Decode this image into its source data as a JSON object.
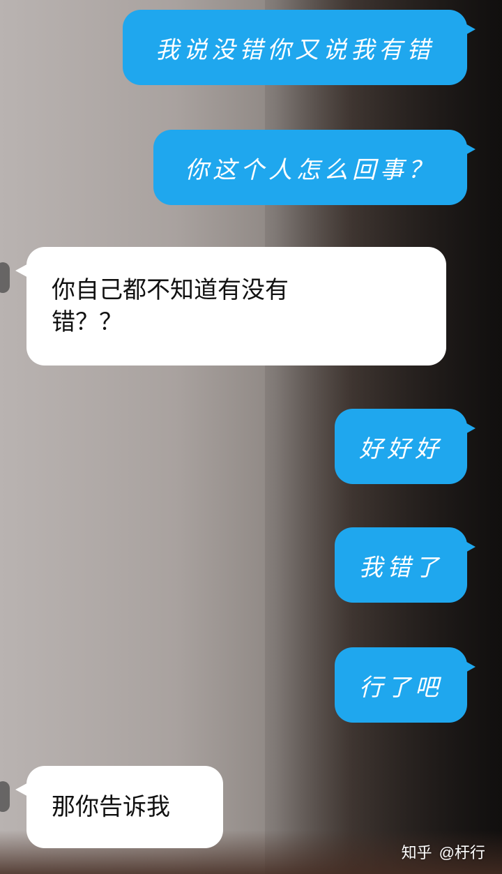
{
  "messages": [
    {
      "side": "right",
      "text": "我说没错你又说我有错"
    },
    {
      "side": "right",
      "text": "你这个人怎么回事？"
    },
    {
      "side": "left",
      "text": "你自己都不知道有没有错？？"
    },
    {
      "side": "right",
      "text": "好好好"
    },
    {
      "side": "right",
      "text": "我错了"
    },
    {
      "side": "right",
      "text": "行了吧"
    },
    {
      "side": "left",
      "text": "那你告诉我"
    }
  ],
  "watermark": {
    "site": "知乎",
    "user": "@杅行"
  },
  "colors": {
    "right_bubble": "#1fa7ee",
    "left_bubble": "#ffffff"
  }
}
